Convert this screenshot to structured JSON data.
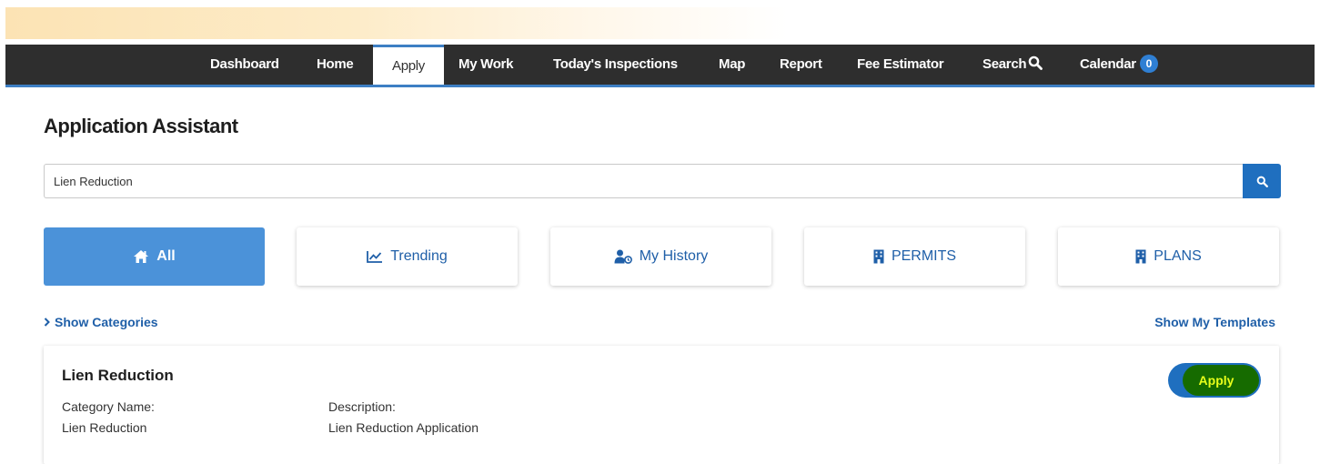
{
  "nav": {
    "items": [
      {
        "label": "Dashboard"
      },
      {
        "label": "Home"
      },
      {
        "label": "Apply",
        "active": true
      },
      {
        "label": "My Work"
      },
      {
        "label": "Today's Inspections"
      },
      {
        "label": "Map"
      },
      {
        "label": "Report"
      },
      {
        "label": "Fee Estimator"
      },
      {
        "label": "Search",
        "icon": "search-icon"
      },
      {
        "label": "Calendar",
        "badge": "0"
      }
    ]
  },
  "page": {
    "title": "Application Assistant"
  },
  "search": {
    "value": "Lien Reduction",
    "button_icon": "search-icon"
  },
  "tabs": [
    {
      "label": "All",
      "icon": "home-icon",
      "active": true
    },
    {
      "label": "Trending",
      "icon": "line-chart-icon"
    },
    {
      "label": "My History",
      "icon": "user-history-icon"
    },
    {
      "label": "PERMITS",
      "icon": "building-icon"
    },
    {
      "label": "PLANS",
      "icon": "building-icon"
    }
  ],
  "links": {
    "show_categories": "Show Categories",
    "show_templates": "Show My Templates"
  },
  "result": {
    "title": "Lien Reduction",
    "category_label": "Category Name:",
    "category_value": "Lien Reduction",
    "description_label": "Description:",
    "description_value": "Lien Reduction Application",
    "apply_label": "Apply"
  },
  "colors": {
    "navbar": "#2e2e2e",
    "accent": "#3d7fc4",
    "primary_button": "#1f6fbf",
    "active_tab": "#4b92d9",
    "link": "#1f5fa8",
    "apply_highlight": "#166b00",
    "apply_text": "#e8ff1a"
  }
}
